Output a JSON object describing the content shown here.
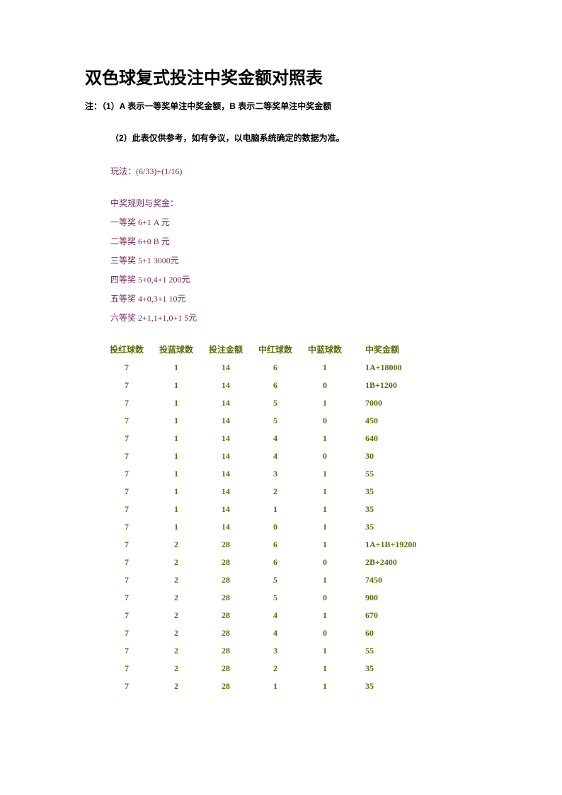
{
  "title": "双色球复式投注中奖金额对照表",
  "note1": "注：（1）A 表示一等奖单注中奖金额，B 表示二等奖单注中奖金额",
  "note2": "（2）此表仅供参考，如有争议，以电脑系统确定的数据为准。",
  "play_label": "玩法：(6/33)+(1/16)",
  "rules_title": "中奖规则与奖金：",
  "rules": [
    "一等奖  6+1   A 元",
    "二等奖  6+0   B 元",
    "三等奖  5+1   3000元",
    "四等奖  5+0,4+1   200元",
    "五等奖  4+0,3+1   10元",
    "六等奖  2+1,1+1,0+1   5元"
  ],
  "headers": {
    "red": "投红球数",
    "blue": "投蓝球数",
    "bet": "投注金额",
    "hitr": "中红球数",
    "hitb": "中蓝球数",
    "prize": "中奖金额"
  },
  "rows": [
    {
      "red": "7",
      "blue": "1",
      "bet": "14",
      "hitr": "6",
      "hitb": "1",
      "prize": "1A+18000"
    },
    {
      "red": "7",
      "blue": "1",
      "bet": "14",
      "hitr": "6",
      "hitb": "0",
      "prize": "1B+1200"
    },
    {
      "red": "7",
      "blue": "1",
      "bet": "14",
      "hitr": "5",
      "hitb": "1",
      "prize": "7000"
    },
    {
      "red": "7",
      "blue": "1",
      "bet": "14",
      "hitr": "5",
      "hitb": "0",
      "prize": "450"
    },
    {
      "red": "7",
      "blue": "1",
      "bet": "14",
      "hitr": "4",
      "hitb": "1",
      "prize": "640"
    },
    {
      "red": "7",
      "blue": "1",
      "bet": "14",
      "hitr": "4",
      "hitb": "0",
      "prize": "30"
    },
    {
      "red": "7",
      "blue": "1",
      "bet": "14",
      "hitr": "3",
      "hitb": "1",
      "prize": "55"
    },
    {
      "red": "7",
      "blue": "1",
      "bet": "14",
      "hitr": "2",
      "hitb": "1",
      "prize": "35"
    },
    {
      "red": "7",
      "blue": "1",
      "bet": "14",
      "hitr": "1",
      "hitb": "1",
      "prize": "35"
    },
    {
      "red": "7",
      "blue": "1",
      "bet": "14",
      "hitr": "0",
      "hitb": "1",
      "prize": "35"
    },
    {
      "red": "7",
      "blue": "2",
      "bet": "28",
      "hitr": "6",
      "hitb": "1",
      "prize": "1A+1B+19200"
    },
    {
      "red": "7",
      "blue": "2",
      "bet": "28",
      "hitr": "6",
      "hitb": "0",
      "prize": "2B+2400"
    },
    {
      "red": "7",
      "blue": "2",
      "bet": "28",
      "hitr": "5",
      "hitb": "1",
      "prize": "7450"
    },
    {
      "red": "7",
      "blue": "2",
      "bet": "28",
      "hitr": "5",
      "hitb": "0",
      "prize": "900"
    },
    {
      "red": "7",
      "blue": "2",
      "bet": "28",
      "hitr": "4",
      "hitb": "1",
      "prize": "670"
    },
    {
      "red": "7",
      "blue": "2",
      "bet": "28",
      "hitr": "4",
      "hitb": "0",
      "prize": "60"
    },
    {
      "red": "7",
      "blue": "2",
      "bet": "28",
      "hitr": "3",
      "hitb": "1",
      "prize": "55"
    },
    {
      "red": "7",
      "blue": "2",
      "bet": "28",
      "hitr": "2",
      "hitb": "1",
      "prize": "35"
    },
    {
      "red": "7",
      "blue": "2",
      "bet": "28",
      "hitr": "1",
      "hitb": "1",
      "prize": "35"
    }
  ]
}
